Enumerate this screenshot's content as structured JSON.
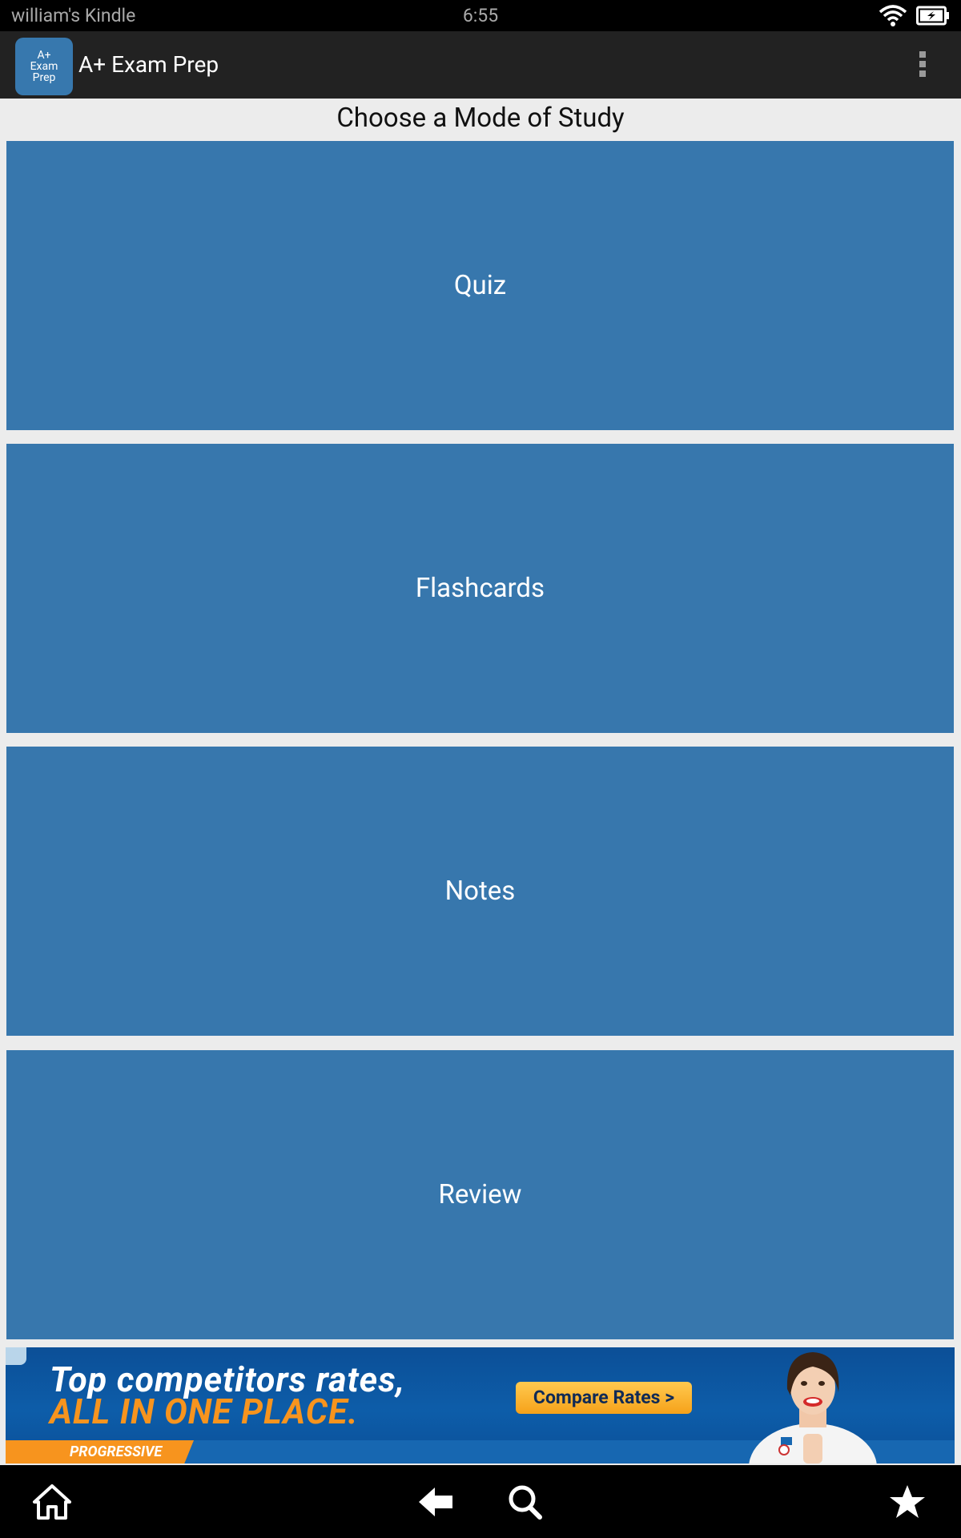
{
  "status_bar": {
    "device_name": "william's Kindle",
    "time": "6:55",
    "icons": [
      "wifi-icon",
      "battery-icon"
    ]
  },
  "action_bar": {
    "app_icon_lines": [
      "A+",
      "Exam",
      "Prep"
    ],
    "title": "A+ Exam Prep",
    "overflow_icon": "overflow-menu-icon"
  },
  "main": {
    "title": "Choose a Mode of Study",
    "modes": [
      {
        "label": "Quiz"
      },
      {
        "label": "Flashcards"
      },
      {
        "label": "Notes"
      },
      {
        "label": "Review"
      }
    ],
    "button_color": "#3777ad"
  },
  "ad": {
    "line1": "Top competitors rates,",
    "line2": "ALL IN ONE PLACE.",
    "cta": "Compare Rates >",
    "brand": "PROGRESSIVE"
  },
  "nav_bar": {
    "icons": [
      "home-icon",
      "back-icon",
      "search-icon",
      "favorites-icon"
    ]
  }
}
